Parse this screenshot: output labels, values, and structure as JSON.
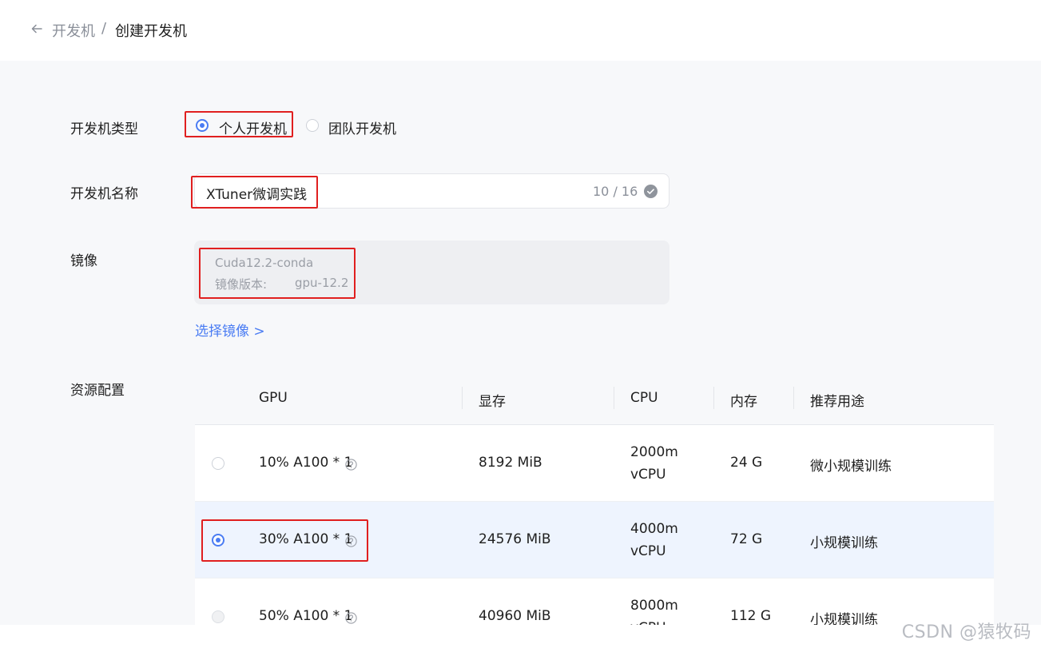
{
  "breadcrumb": {
    "parent": "开发机",
    "separator": "/",
    "current": "创建开发机"
  },
  "form": {
    "type_label": "开发机类型",
    "type_options": [
      "个人开发机",
      "团队开发机"
    ],
    "type_selected": "个人开发机",
    "name_label": "开发机名称",
    "name_value": "XTuner微调实践",
    "name_count": "10 / 16",
    "image_label": "镜像",
    "image_name": "Cuda12.2-conda",
    "image_version_label": "镜像版本:",
    "image_version_value": "gpu-12.2",
    "select_image_link": "选择镜像 >",
    "resource_label": "资源配置"
  },
  "resource_table": {
    "headers": [
      "GPU",
      "显存",
      "CPU",
      "内存",
      "推荐用途"
    ],
    "rows": [
      {
        "gpu": "10% A100 * 1",
        "memory_gpu": "8192 MiB",
        "cpu_value": "2000m",
        "cpu_unit": "vCPU",
        "ram": "24 G",
        "usage": "微小规模训练",
        "selected": false
      },
      {
        "gpu": "30% A100 * 1",
        "memory_gpu": "24576 MiB",
        "cpu_value": "4000m",
        "cpu_unit": "vCPU",
        "ram": "72 G",
        "usage": "小规模训练",
        "selected": true
      },
      {
        "gpu": "50% A100 * 1",
        "memory_gpu": "40960 MiB",
        "cpu_value": "8000m",
        "cpu_unit": "vCPU",
        "ram": "112 G",
        "usage": "小规模训练",
        "selected": false
      }
    ]
  },
  "watermark": "CSDN @猿牧码",
  "colors": {
    "accent": "#4a7cf3",
    "highlight_box": "#e01f1f",
    "selected_row": "#eef4fe",
    "page_bg": "#f7f8fa"
  },
  "icons": {
    "back": "arrow-left-icon",
    "check": "check-circle-icon",
    "help": "question-circle-icon"
  }
}
